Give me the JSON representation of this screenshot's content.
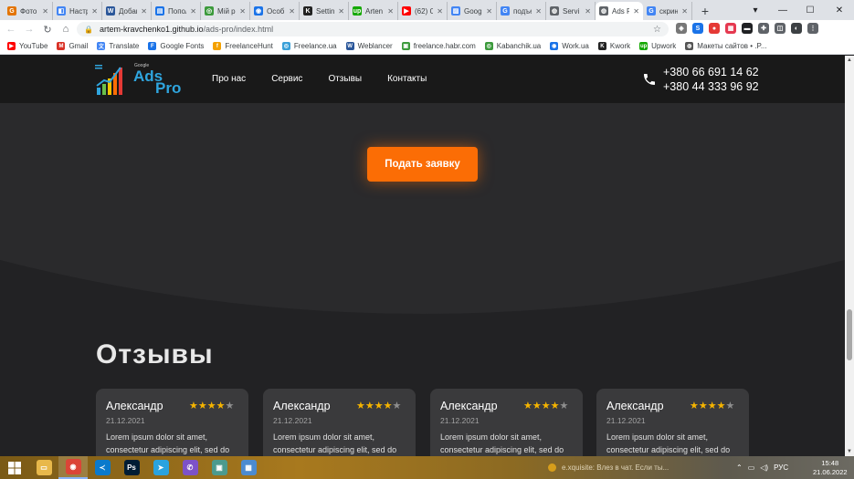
{
  "browser": {
    "tabs": [
      {
        "title": "Фото",
        "color": "#e37400",
        "glyph": "G"
      },
      {
        "title": "Настр",
        "color": "#4285f4",
        "glyph": "◧"
      },
      {
        "title": "Добав",
        "color": "#2b579a",
        "glyph": "W"
      },
      {
        "title": "Попол",
        "color": "#1a73e8",
        "glyph": "▤"
      },
      {
        "title": "Мій р",
        "color": "#3c9a3c",
        "glyph": "◎"
      },
      {
        "title": "Особ",
        "color": "#1a73e8",
        "glyph": "◉"
      },
      {
        "title": "Settin",
        "color": "#222222",
        "glyph": "K"
      },
      {
        "title": "Arten",
        "color": "#14a800",
        "glyph": "up"
      },
      {
        "title": "(62) С",
        "color": "#ff0000",
        "glyph": "▶"
      },
      {
        "title": "Goog",
        "color": "#4285f4",
        "glyph": "▨"
      },
      {
        "title": "подъе",
        "color": "#4285f4",
        "glyph": "G"
      },
      {
        "title": "Servi",
        "color": "#5f6368",
        "glyph": "◍"
      },
      {
        "title": "Ads P",
        "color": "#5f6368",
        "glyph": "◍",
        "active": true
      },
      {
        "title": "скрин",
        "color": "#4285f4",
        "glyph": "G"
      }
    ],
    "new_tab": "+",
    "window_controls": [
      "▾",
      "—",
      "☐",
      "✕"
    ],
    "nav": {
      "back": "←",
      "forward": "→",
      "reload": "↻",
      "home": "⌂"
    },
    "url_host": "artem-kravchenko1.github.io",
    "url_path": "/ads-pro/index.html",
    "lock_icon": "🔒",
    "star_icon": "☆",
    "extensions": [
      {
        "name": "shield-icon",
        "glyph": "◈",
        "color": "#777777"
      },
      {
        "name": "vpn-icon",
        "glyph": "S",
        "color": "#1a73e8"
      },
      {
        "name": "red-ext-icon",
        "glyph": "●",
        "color": "#e53935"
      },
      {
        "name": "ext-icon",
        "glyph": "▦",
        "color": "#e53950"
      },
      {
        "name": "pocket-icon",
        "glyph": "▬",
        "color": "#202124"
      },
      {
        "name": "puzzle-icon",
        "glyph": "✚",
        "color": "#5f6368"
      },
      {
        "name": "sidepanel-icon",
        "glyph": "◫",
        "color": "#5f6368"
      },
      {
        "name": "avatar-icon",
        "glyph": "◐",
        "color": "#3c4043"
      },
      {
        "name": "menu-icon",
        "glyph": "⋮",
        "color": "#5f6368"
      }
    ],
    "bookmarks": [
      {
        "label": "YouTube",
        "color": "#ff0000",
        "glyph": "▶"
      },
      {
        "label": "Gmail",
        "color": "#d93025",
        "glyph": "M"
      },
      {
        "label": "Translate",
        "color": "#4285f4",
        "glyph": "文"
      },
      {
        "label": "Google Fonts",
        "color": "#1a73e8",
        "glyph": "F"
      },
      {
        "label": "FreelanceHunt",
        "color": "#f4a100",
        "glyph": "f"
      },
      {
        "label": "Freelance.ua",
        "color": "#3aa0d8",
        "glyph": "◎"
      },
      {
        "label": "Weblancer",
        "color": "#2b579a",
        "glyph": "W"
      },
      {
        "label": "freelance.habr.com",
        "color": "#3c9a3c",
        "glyph": "▣"
      },
      {
        "label": "Kabanchik.ua",
        "color": "#3c9a3c",
        "glyph": "◎"
      },
      {
        "label": "Work.ua",
        "color": "#1a73e8",
        "glyph": "◉"
      },
      {
        "label": "Kwork",
        "color": "#222222",
        "glyph": "K"
      },
      {
        "label": "Upwork",
        "color": "#14a800",
        "glyph": "up"
      },
      {
        "label": "Макеты сайтов • .P...",
        "color": "#555555",
        "glyph": "◍"
      }
    ]
  },
  "site": {
    "logo": {
      "small": "Google",
      "ads": "Ads",
      "pro": "Pro"
    },
    "nav": [
      "Про нас",
      "Сервис",
      "Отзывы",
      "Контакты"
    ],
    "phones": [
      "+380 66 691 14 62",
      "+380 44 333 96 92"
    ],
    "cta_label": "Подать заявку",
    "reviews_title": "Отзывы",
    "reviews": [
      {
        "name": "Александр",
        "date": "21.12.2021",
        "rating": 4,
        "text": "Lorem ipsum dolor sit amet, consectetur adipiscing elit, sed do"
      },
      {
        "name": "Александр",
        "date": "21.12.2021",
        "rating": 4,
        "text": "Lorem ipsum dolor sit amet, consectetur adipiscing elit, sed do"
      },
      {
        "name": "Александр",
        "date": "21.12.2021",
        "rating": 4,
        "text": "Lorem ipsum dolor sit amet, consectetur adipiscing elit, sed do"
      },
      {
        "name": "Александр",
        "date": "21.12.2021",
        "rating": 4,
        "text": "Lorem ipsum dolor sit amet, consectetur adipiscing elit, sed do"
      }
    ],
    "colors": {
      "accent": "#fb6d05",
      "logo": "#2fa5de",
      "star": "#f5b400"
    }
  },
  "taskbar": {
    "apps": [
      {
        "name": "file-explorer-icon",
        "glyph": "▭",
        "color": "#e8b84a"
      },
      {
        "name": "chrome-icon",
        "glyph": "◉",
        "color": "#db4437",
        "active": true
      },
      {
        "name": "vscode-icon",
        "glyph": "≺",
        "color": "#0a7acc"
      },
      {
        "name": "photoshop-icon",
        "glyph": "Ps",
        "color": "#001d34"
      },
      {
        "name": "telegram-icon",
        "glyph": "➤",
        "color": "#2aa3df"
      },
      {
        "name": "viber-icon",
        "glyph": "✆",
        "color": "#7d52c8"
      },
      {
        "name": "app-icon",
        "glyph": "▣",
        "color": "#4c9a8e"
      },
      {
        "name": "control-panel-icon",
        "glyph": "▦",
        "color": "#4c8bd0"
      }
    ],
    "notification": "e.xquisite: Влез в чат. Если ты...",
    "tray_lang": "РУС",
    "time": "15:48",
    "date": "21.06.2022"
  }
}
